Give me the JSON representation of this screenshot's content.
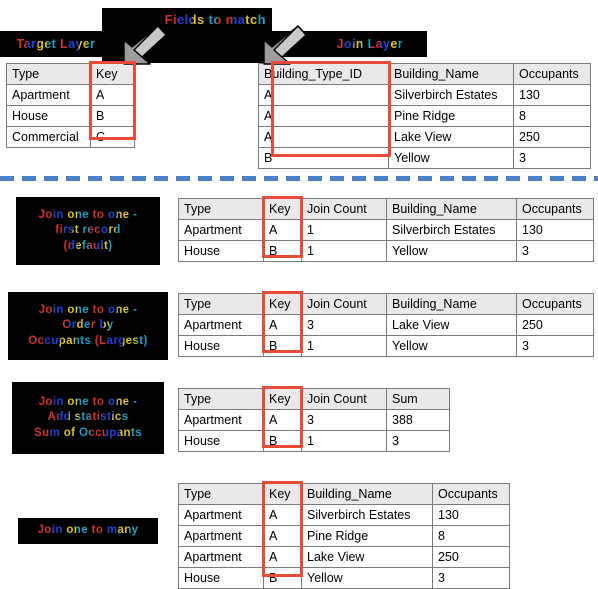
{
  "diagram": {
    "title_fields_to_match": "Fields to match",
    "target_layer_label": "Target Layer",
    "join_layer_label": "Join Layer"
  },
  "target_table": {
    "headers": [
      "Type",
      "Key"
    ],
    "rows": [
      [
        "Apartment",
        "A"
      ],
      [
        "House",
        "B"
      ],
      [
        "Commercial",
        "C"
      ]
    ]
  },
  "join_table": {
    "headers": [
      "Building_Type_ID",
      "Building_Name",
      "Occupants"
    ],
    "rows": [
      [
        "A",
        "Silverbirch Estates",
        "130"
      ],
      [
        "A",
        "Pine Ridge",
        "8"
      ],
      [
        "A",
        "Lake View",
        "250"
      ],
      [
        "B",
        "Yellow",
        "3"
      ]
    ]
  },
  "cases": [
    {
      "label_lines": [
        "Join one to one -",
        "first record",
        "(default)"
      ],
      "headers": [
        "Type",
        "Key",
        "Join Count",
        "Building_Name",
        "Occupants"
      ],
      "rows": [
        [
          "Apartment",
          "A",
          "1",
          "Silverbirch Estates",
          "130"
        ],
        [
          "House",
          "B",
          "1",
          "Yellow",
          "3"
        ]
      ]
    },
    {
      "label_lines": [
        "Join one to one -",
        "Order by",
        "Occupants (Largest)"
      ],
      "headers": [
        "Type",
        "Key",
        "Join Count",
        "Building_Name",
        "Occupants"
      ],
      "rows": [
        [
          "Apartment",
          "A",
          "3",
          "Lake View",
          "250"
        ],
        [
          "House",
          "B",
          "1",
          "Yellow",
          "3"
        ]
      ]
    },
    {
      "label_lines": [
        "Join one to one -",
        "Add statistics",
        "Sum of Occupants"
      ],
      "headers": [
        "Type",
        "Key",
        "Join Count",
        "Sum"
      ],
      "rows": [
        [
          "Apartment",
          "A",
          "3",
          "388"
        ],
        [
          "House",
          "B",
          "1",
          "3"
        ]
      ]
    },
    {
      "label_lines": [
        "Join one to many"
      ],
      "headers": [
        "Type",
        "Key",
        "Building_Name",
        "Occupants"
      ],
      "rows": [
        [
          "Apartment",
          "A",
          "Silverbirch Estates",
          "130"
        ],
        [
          "Apartment",
          "A",
          "Pine Ridge",
          "8"
        ],
        [
          "Apartment",
          "A",
          "Lake View",
          "250"
        ],
        [
          "House",
          "B",
          "Yellow",
          "3"
        ]
      ]
    }
  ],
  "colors": {
    "highlight_red": "#ea4a38",
    "divider_blue": "#4a7ec9",
    "header_gray": "#e9e9e9",
    "plate_black": "#000000"
  }
}
